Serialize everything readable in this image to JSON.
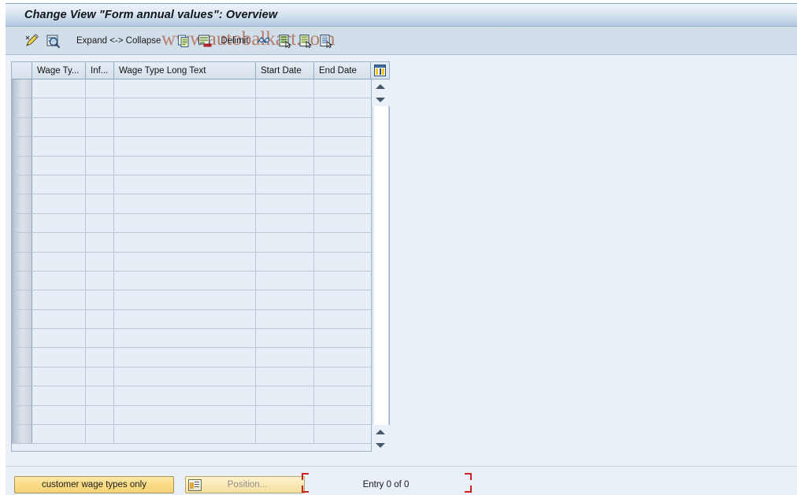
{
  "window": {
    "title": "Change View \"Form annual values\": Overview"
  },
  "watermark": {
    "text": "www.autobalkart.com"
  },
  "toolbar": {
    "items": [
      {
        "name": "display-change-icon",
        "label": ""
      },
      {
        "name": "details-icon",
        "label": ""
      },
      {
        "name": "expand-collapse",
        "label": "Expand <-> Collapse"
      },
      {
        "name": "copy-as-icon",
        "label": ""
      },
      {
        "name": "delete-icon",
        "label": ""
      },
      {
        "name": "delimit",
        "label": "Delimit"
      },
      {
        "name": "undo-icon",
        "label": ""
      },
      {
        "name": "select-all-icon",
        "label": ""
      },
      {
        "name": "deselect-all-icon",
        "label": ""
      },
      {
        "name": "select-block-icon",
        "label": ""
      }
    ],
    "expand_collapse_label": "Expand <-> Collapse",
    "delimit_label": "Delimit"
  },
  "table": {
    "columns": [
      {
        "key": "select",
        "label": ""
      },
      {
        "key": "wage_type",
        "label": "Wage Ty..."
      },
      {
        "key": "infotype",
        "label": "Inf..."
      },
      {
        "key": "long_text",
        "label": "Wage Type Long Text"
      },
      {
        "key": "start_date",
        "label": "Start Date"
      },
      {
        "key": "end_date",
        "label": "End Date"
      }
    ],
    "config_icon": "column-settings-icon",
    "rows": [],
    "empty_row_count": 19
  },
  "scrollbar": {
    "up_arrow": "scroll-up-icon",
    "down_arrow": "scroll-down-icon"
  },
  "footer": {
    "customer_button_label": "customer wage types only",
    "position_placeholder": "Position...",
    "position_value": "",
    "position_icon": "position-icon",
    "entry_status": "Entry 0 of 0"
  },
  "colors": {
    "title_bar_top": "#eef4fa",
    "title_bar_bottom": "#b0c8e0",
    "toolbar_bg": "#d2dfea",
    "body_bg": "#eaf0f7",
    "grid_cell_bg": "#e8eef6",
    "grid_border": "#9bb2c8",
    "accent_yellow": "#fbdc86",
    "bracket_red": "#cc2222",
    "watermark": "#a8421e"
  }
}
